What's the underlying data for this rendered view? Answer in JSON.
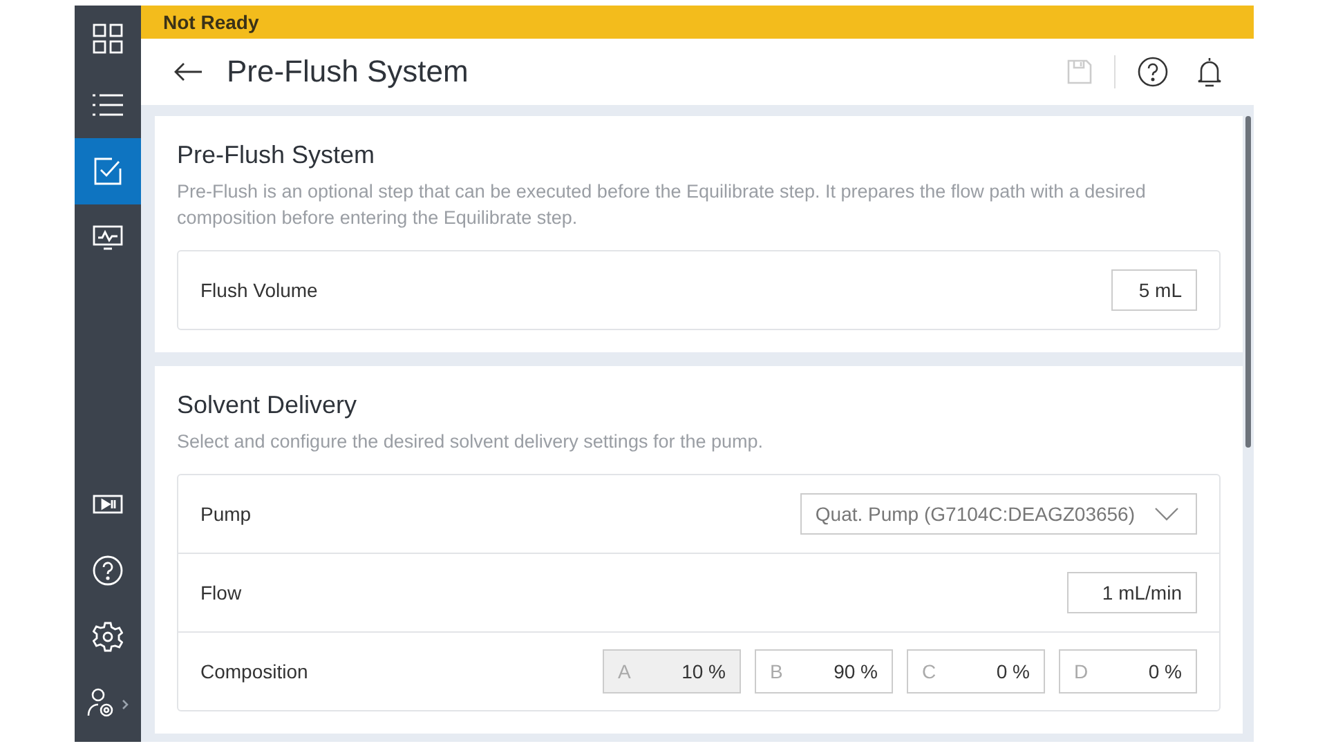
{
  "status_bar": {
    "text": "Not Ready"
  },
  "header": {
    "title": "Pre-Flush System",
    "save_disabled": true
  },
  "sidebar": {
    "top_items": [
      {
        "kind": "grid",
        "selected": false
      },
      {
        "kind": "list",
        "selected": false
      },
      {
        "kind": "check",
        "selected": true
      },
      {
        "kind": "monitor",
        "selected": false
      }
    ],
    "bottom_items": [
      {
        "kind": "playpause",
        "selected": false
      },
      {
        "kind": "help",
        "selected": false
      },
      {
        "kind": "gear",
        "selected": false
      },
      {
        "kind": "usergear",
        "selected": false
      }
    ]
  },
  "sections": [
    {
      "title": "Pre-Flush System",
      "description": "Pre-Flush is an optional step that can be executed before the Equilibrate step. It prepares the flow path with a desired composition before entering the Equilibrate step.",
      "rows": [
        {
          "kind": "input",
          "label": "Flush Volume",
          "value": "5 mL"
        }
      ]
    },
    {
      "title": "Solvent Delivery",
      "description": "Select and configure the desired solvent delivery settings for the pump.",
      "rows": [
        {
          "kind": "select",
          "label": "Pump",
          "value": "Quat. Pump (G7104C:DEAGZ03656)"
        },
        {
          "kind": "input",
          "label": "Flow",
          "value": "1 mL/min"
        },
        {
          "kind": "composition",
          "label": "Composition",
          "channels": [
            {
              "name": "A",
              "value": "10 %",
              "disabled": true
            },
            {
              "name": "B",
              "value": "90 %",
              "disabled": false
            },
            {
              "name": "C",
              "value": "0 %",
              "disabled": false
            },
            {
              "name": "D",
              "value": "0 %",
              "disabled": false
            }
          ]
        }
      ]
    }
  ]
}
